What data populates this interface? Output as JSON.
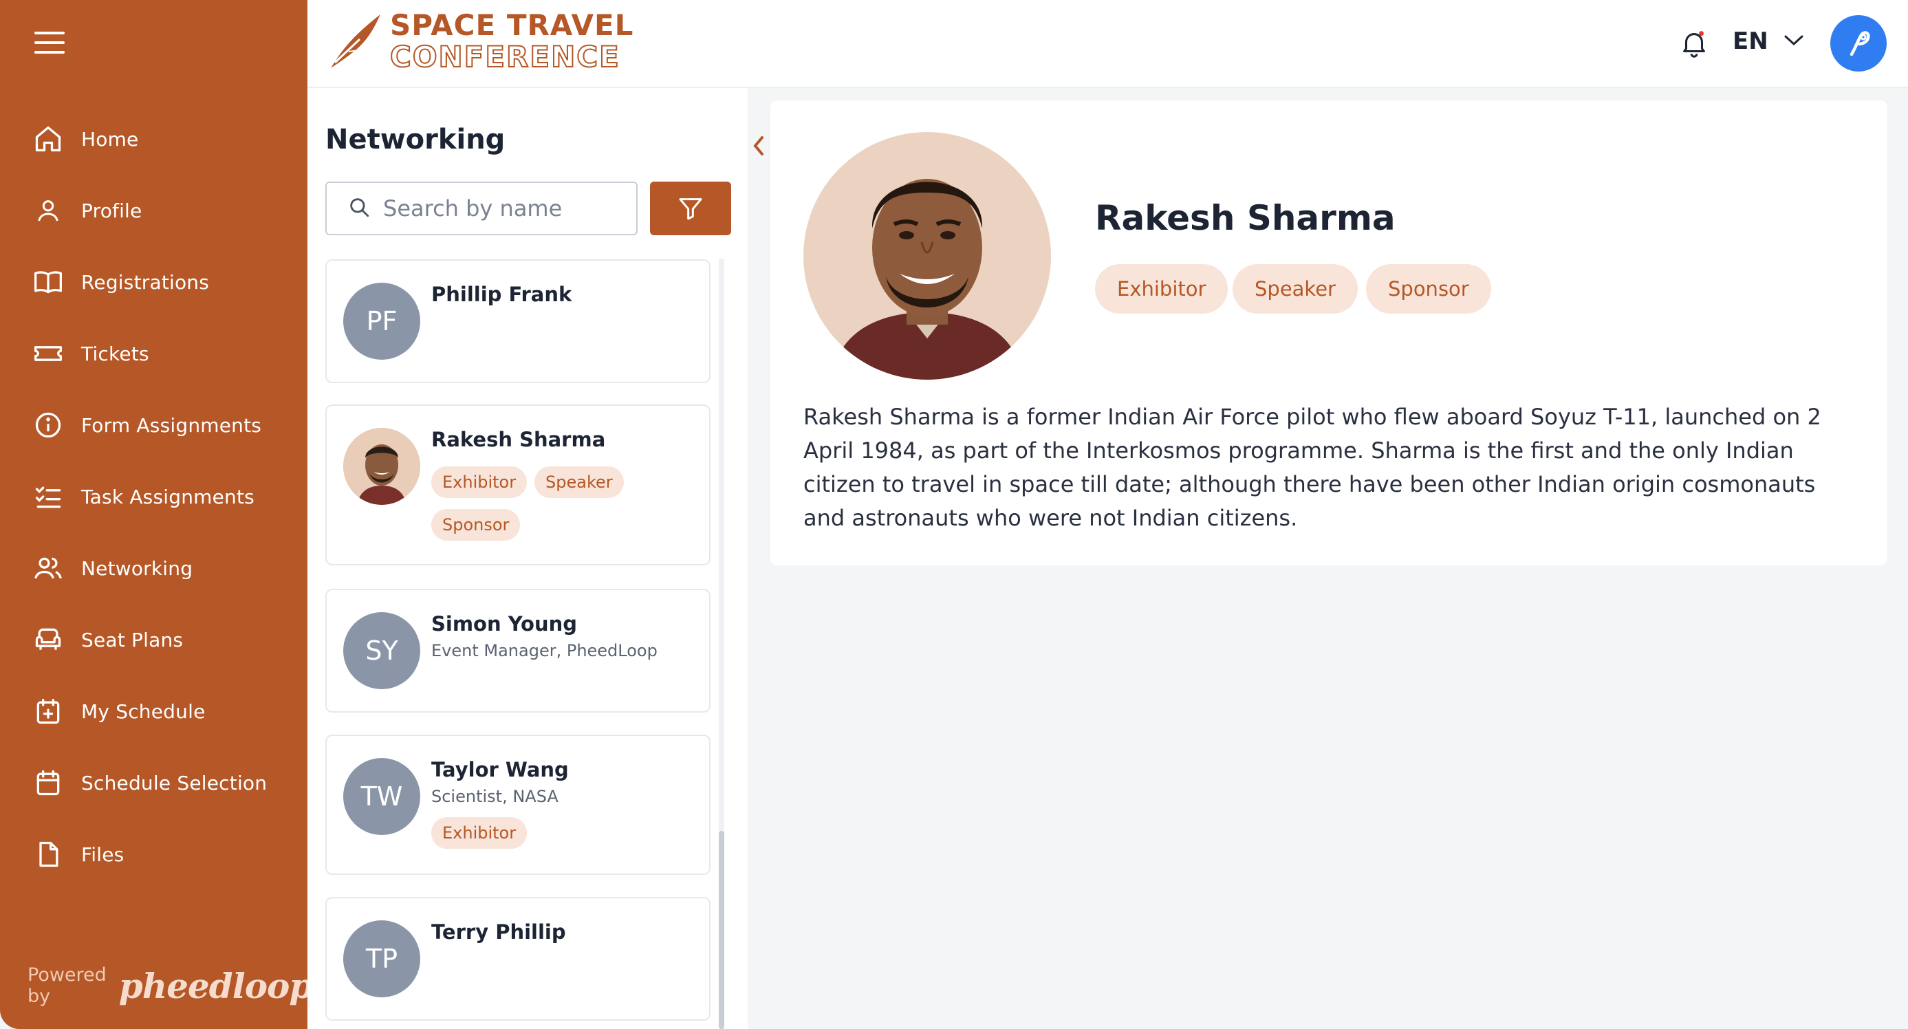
{
  "sidebar": {
    "items": [
      {
        "label": "Home",
        "icon": "home-icon"
      },
      {
        "label": "Profile",
        "icon": "user-icon"
      },
      {
        "label": "Registrations",
        "icon": "book-icon"
      },
      {
        "label": "Tickets",
        "icon": "ticket-icon"
      },
      {
        "label": "Form Assignments",
        "icon": "info-icon"
      },
      {
        "label": "Task Assignments",
        "icon": "checklist-icon"
      },
      {
        "label": "Networking",
        "icon": "users-icon"
      },
      {
        "label": "Seat Plans",
        "icon": "armchair-icon"
      },
      {
        "label": "My Schedule",
        "icon": "calendar-plus-icon"
      },
      {
        "label": "Schedule Selection",
        "icon": "calendar-icon"
      },
      {
        "label": "Files",
        "icon": "file-icon"
      }
    ],
    "powered_by": "Powered by",
    "powered_brand": "pheedloop"
  },
  "header": {
    "logo_line1": "SPACE TRAVEL",
    "logo_line2": "CONFERENCE",
    "language": "EN"
  },
  "networking": {
    "title": "Networking",
    "search_placeholder": "Search by name",
    "people": [
      {
        "initials": "PF",
        "name": "Phillip Frank",
        "subtitle": "",
        "tags": []
      },
      {
        "initials": "",
        "name": "Rakesh Sharma",
        "subtitle": "",
        "tags": [
          "Exhibitor",
          "Speaker",
          "Sponsor"
        ]
      },
      {
        "initials": "SY",
        "name": "Simon Young",
        "subtitle": "Event Manager, PheedLoop",
        "tags": []
      },
      {
        "initials": "TW",
        "name": "Taylor Wang",
        "subtitle": "Scientist, NASA",
        "tags": [
          "Exhibitor"
        ]
      },
      {
        "initials": "TP",
        "name": "Terry Phillip",
        "subtitle": "",
        "tags": []
      }
    ]
  },
  "detail": {
    "name": "Rakesh Sharma",
    "tags": [
      "Exhibitor",
      "Speaker",
      "Sponsor"
    ],
    "bio": "Rakesh Sharma is a former Indian Air Force pilot who flew aboard Soyuz T-11, launched on 2 April 1984, as part of the Interkosmos programme. Sharma is the first and the only Indian citizen to travel in space till date; although there have been other Indian origin cosmonauts and astronauts who were not Indian citizens."
  },
  "colors": {
    "brand": "#b55726",
    "tag_bg": "#f8e4d8",
    "avatar_blue": "#2f7df0",
    "initials_bg": "#8a96a8"
  }
}
